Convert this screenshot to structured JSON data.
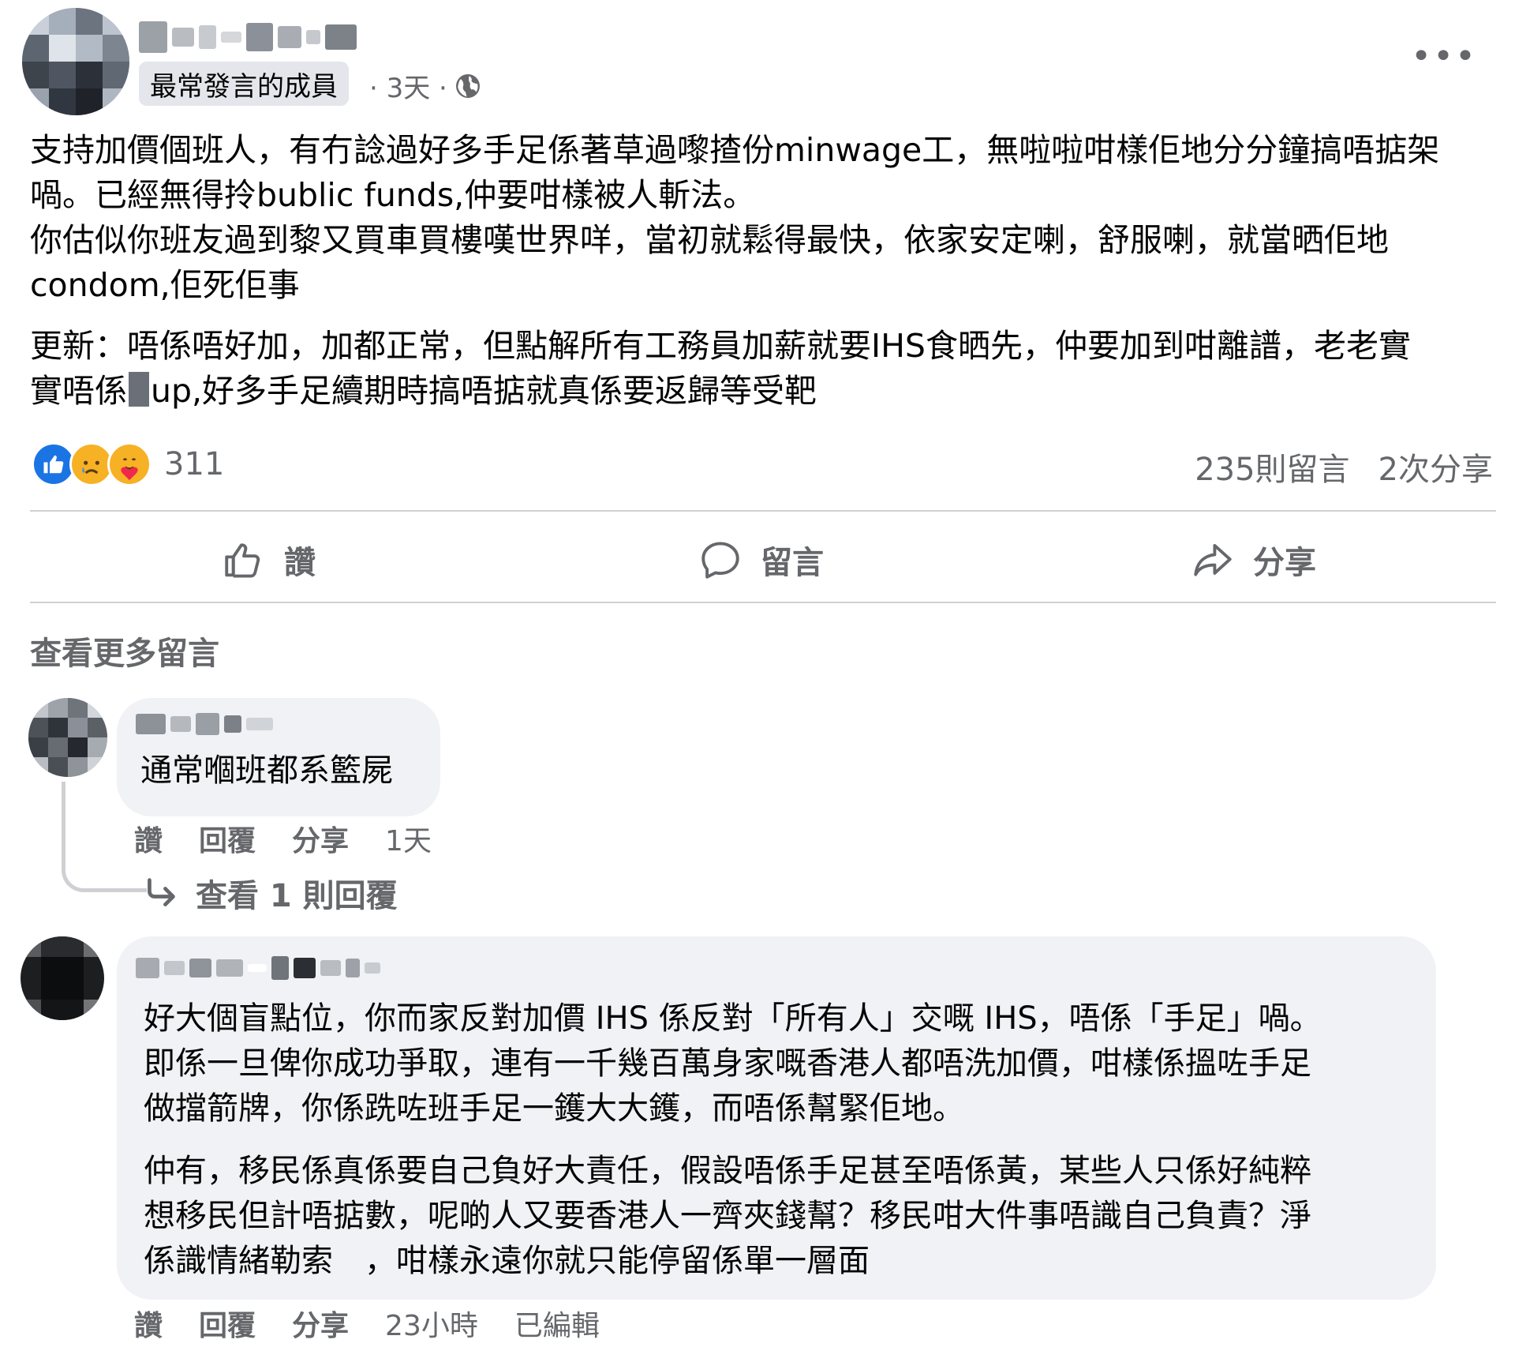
{
  "post": {
    "badge": "最常發言的成員",
    "meta_time": "· 3天 ·",
    "more_label": "•••",
    "body_lines": [
      "支持加價個班人，有冇諗過好多手足係著草過嚟揸份minwage工，無啦啦咁樣佢地分分鐘搞唔掂架",
      "喎。已經無得拎bublic funds,仲要咁樣被人斬法。",
      "你估似你班友過到黎又買車買樓嘆世界咩，當初就鬆得最快，依家安定喇，舒服喇，就當晒佢地",
      "condom,佢死佢事"
    ],
    "update_lines": [
      "更新：唔係唔好加，加都正常，但點解所有工務員加薪就要IHS食晒先，仲要加到咁離譜，老老實",
      "up,好多手足續期時搞唔掂就真係要返歸等受靶"
    ],
    "update_prefix": "實唔係",
    "reaction_count": "311",
    "reaction_emojis": [
      "👍",
      "😥",
      "🥰"
    ],
    "comments_count": "235則留言",
    "shares_count": "2次分享"
  },
  "actions": {
    "like": "讚",
    "comment": "留言",
    "share": "分享"
  },
  "view_more_comments": "查看更多留言",
  "comments": [
    {
      "text": "通常嗰班都系籃屍",
      "like": "讚",
      "reply": "回覆",
      "share": "分享",
      "time": "1天",
      "view_replies": "查看 1 則回覆"
    },
    {
      "paragraph1": [
        "好大個盲點位，你而家反對加價 IHS 係反對「所有人」交嘅 IHS，唔係「手足」喎。",
        "即係一旦俾你成功爭取，連有一千幾百萬身家嘅香港人都唔洗加價，咁樣係搵咗手足",
        "做擋箭牌，你係跣咗班手足一鑊大大鑊，而唔係幫緊佢地。"
      ],
      "paragraph2": [
        "仲有，移民係真係要自己負好大責任，假設唔係手足甚至唔係黃，某些人只係好純粹",
        "想移民但計唔掂數，呢啲人又要香港人一齊夾錢幫？移民咁大件事唔識自己負責？淨",
        "係識情緒勒索　，咁樣永遠你就只能停留係單一層面"
      ],
      "like": "讚",
      "reply": "回覆",
      "share": "分享",
      "time": "23小時",
      "edited": "已編輯"
    }
  ],
  "colors": {
    "text_primary": "#050505",
    "text_secondary": "#65676b",
    "bubble_bg": "#f0f2f5",
    "divider": "#ced0d4",
    "like_blue": "#1b74e4"
  }
}
